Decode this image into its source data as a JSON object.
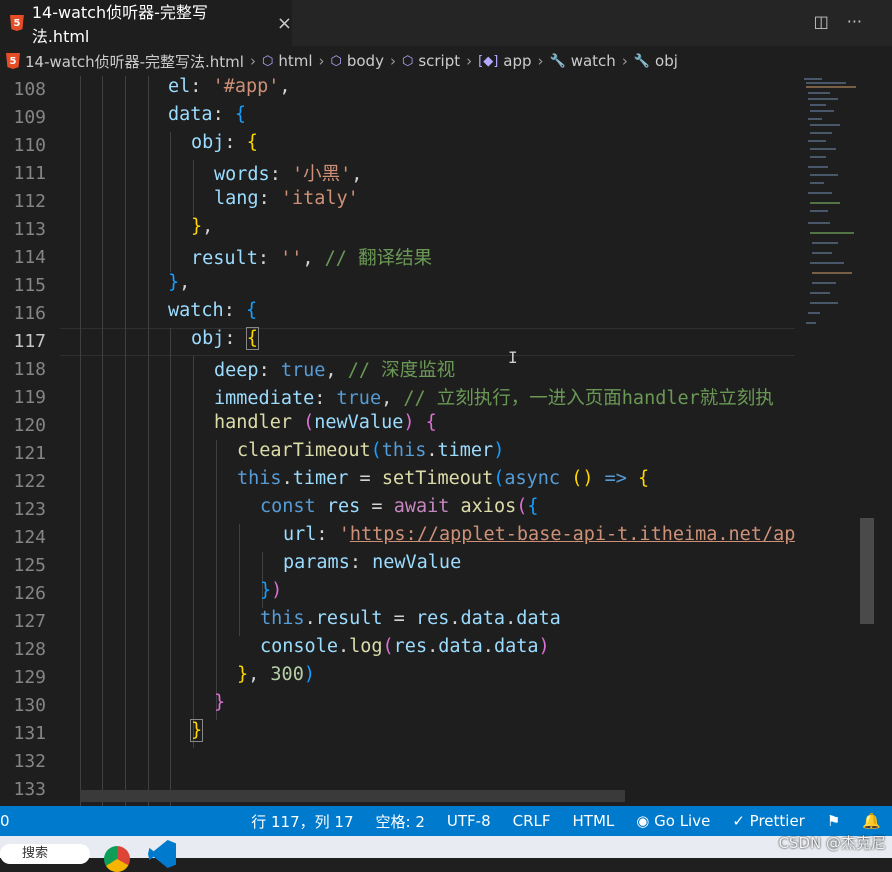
{
  "tab": {
    "icon": "5",
    "title": "14-watch侦听器-完整写法.html",
    "close": "×"
  },
  "tab_actions": {
    "split": "◫",
    "more": "···"
  },
  "breadcrumb": {
    "file": "14-watch侦听器-完整写法.html",
    "items": [
      {
        "label": "html",
        "icon": "cube-icon"
      },
      {
        "label": "body",
        "icon": "cube-icon"
      },
      {
        "label": "script",
        "icon": "cube-icon"
      },
      {
        "label": "app",
        "icon": "variable-icon"
      },
      {
        "label": "watch",
        "icon": "wrench-icon"
      },
      {
        "label": "obj",
        "icon": "wrench-icon"
      }
    ]
  },
  "editor": {
    "active_line": "117",
    "line_numbers": [
      "108",
      "109",
      "110",
      "111",
      "112",
      "113",
      "114",
      "115",
      "116",
      "117",
      "118",
      "119",
      "120",
      "121",
      "122",
      "123",
      "124",
      "125",
      "126",
      "127",
      "128",
      "129",
      "130",
      "131",
      "132",
      "133"
    ],
    "code": {
      "l108": {
        "prop": "el",
        "p1": ": ",
        "str": "'#app'",
        "p2": ","
      },
      "l109": {
        "prop": "data",
        "p1": ": ",
        "b": "{"
      },
      "l110": {
        "prop": "obj",
        "p1": ": ",
        "b": "{"
      },
      "l111": {
        "prop": "words",
        "p1": ": ",
        "str": "'小黑'",
        "p2": ","
      },
      "l112": {
        "prop": "lang",
        "p1": ": ",
        "str": "'italy'"
      },
      "l113": {
        "b": "}",
        "p": ","
      },
      "l114": {
        "prop": "result",
        "p1": ": ",
        "str": "''",
        "p2": ", ",
        "cmt": "// 翻译结果"
      },
      "l115": {
        "b": "}",
        "p": ","
      },
      "l116": {
        "prop": "watch",
        "p1": ": ",
        "b": "{"
      },
      "l117": {
        "prop": "obj",
        "p1": ": ",
        "b": "{"
      },
      "l118": {
        "prop": "deep",
        "p1": ": ",
        "kw": "true",
        "p2": ", ",
        "cmt": "// 深度监视"
      },
      "l119": {
        "prop": "immediate",
        "p1": ": ",
        "kw": "true",
        "p2": ", ",
        "cmt": "// 立刻执行，一进入页面handler就立刻执"
      },
      "l120": {
        "fn": "handler",
        "sp": " ",
        "b1": "(",
        "param": "newValue",
        "b2": ")",
        "sp2": " ",
        "b3": "{"
      },
      "l121": {
        "fn": "clearTimeout",
        "b1": "(",
        "kw": "this",
        "p": ".",
        "prop": "timer",
        "b2": ")"
      },
      "l122": {
        "kw": "this",
        "p": ".",
        "prop": "timer",
        "p2": " = ",
        "fn": "setTimeout",
        "b1": "(",
        "kw2": "async",
        "sp": " ",
        "b2": "()",
        "arrow": " => ",
        "b3": "{"
      },
      "l123": {
        "kw": "const",
        "sp": " ",
        "var": "res",
        "p": " = ",
        "ctl": "await",
        "sp2": " ",
        "fn": "axios",
        "b1": "(",
        "b2": "{"
      },
      "l124": {
        "prop": "url",
        "p1": ": ",
        "q": "'",
        "url": "https://applet-base-api-t.itheima.net/ap"
      },
      "l125": {
        "prop": "params",
        "p1": ": ",
        "var": "newValue"
      },
      "l126": {
        "b1": "}",
        "b2": ")"
      },
      "l127": {
        "kw": "this",
        "p": ".",
        "prop": "result",
        "p2": " = ",
        "var": "res",
        "p3": ".",
        "prop2": "data",
        "p4": ".",
        "prop3": "data"
      },
      "l128": {
        "var": "console",
        "p": ".",
        "fn": "log",
        "b1": "(",
        "var2": "res",
        "p2": ".",
        "prop": "data",
        "p3": ".",
        "prop2": "data",
        "b2": ")"
      },
      "l129": {
        "b1": "}",
        "p": ", ",
        "num": "300",
        "b2": ")"
      },
      "l130": {
        "b": "}"
      },
      "l131": {
        "b": "}"
      }
    },
    "text_cursor": "I"
  },
  "statusbar": {
    "left": "0",
    "position": "行 117，列 17",
    "spaces": "空格: 2",
    "encoding": "UTF-8",
    "eol": "CRLF",
    "language": "HTML",
    "golive": "Go Live",
    "prettier": "Prettier"
  },
  "taskbar": {
    "search": "搜索"
  },
  "watermark": "CSDN @杰克尼",
  "colors": {
    "statusbar": "#007acc",
    "editor_bg": "#1e1e1e",
    "html_icon": "#e44d26"
  }
}
